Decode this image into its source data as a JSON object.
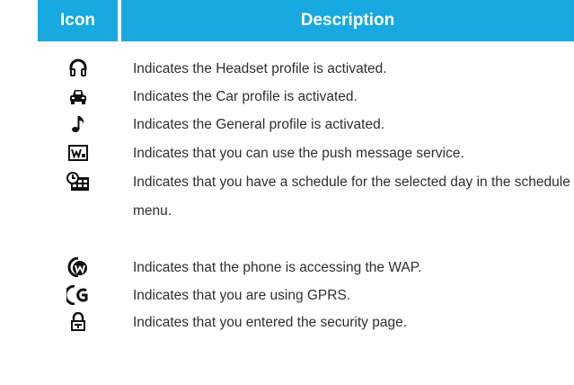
{
  "table": {
    "headers": {
      "icon": "Icon",
      "description": "Description"
    },
    "rows": [
      {
        "icon": "headset-icon",
        "description": "Indicates the Headset profile is activated."
      },
      {
        "icon": "car-icon",
        "description": "Indicates the Car profile is activated."
      },
      {
        "icon": "music-note-icon",
        "description": "Indicates the General profile is activated."
      },
      {
        "icon": "push-message-icon",
        "description": "Indicates that you can use the push message service."
      },
      {
        "icon": "schedule-icon",
        "description": "Indicates that you have a schedule for the selected day in the schedule menu."
      },
      {
        "icon": "wap-icon",
        "description": "Indicates that the phone is accessing the WAP."
      },
      {
        "icon": "gprs-icon",
        "description": "Indicates that you are using GPRS."
      },
      {
        "icon": "security-lock-icon",
        "description": "Indicates that you entered the security page."
      }
    ]
  }
}
